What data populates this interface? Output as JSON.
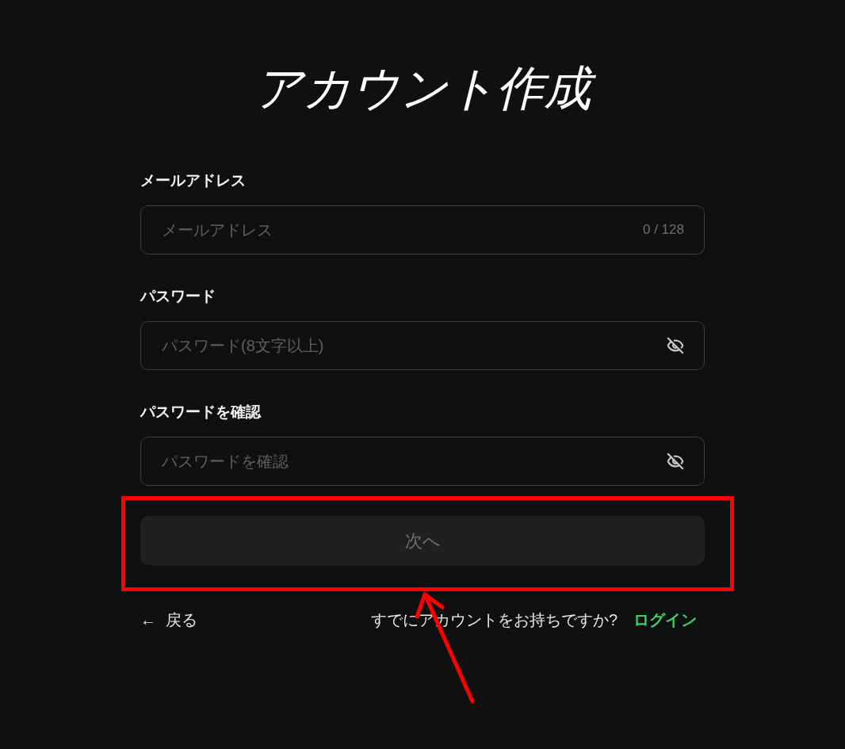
{
  "title": "アカウント作成",
  "fields": [
    {
      "label": "メールアドレス",
      "placeholder": "メールアドレス",
      "kind": "counter",
      "counter": "0 / 128"
    },
    {
      "label": "パスワード",
      "placeholder": "パスワード(8文字以上)",
      "kind": "password",
      "revealed": false
    },
    {
      "label": "パスワードを確認",
      "placeholder": "パスワードを確認",
      "kind": "password",
      "revealed": false
    }
  ],
  "next_button": {
    "label": "次へ",
    "disabled": true
  },
  "back_link": {
    "arrow": "←",
    "label": "戻る"
  },
  "login_prompt": {
    "text": "すでにアカウントをお持ちですか?",
    "link": "ログイン"
  }
}
